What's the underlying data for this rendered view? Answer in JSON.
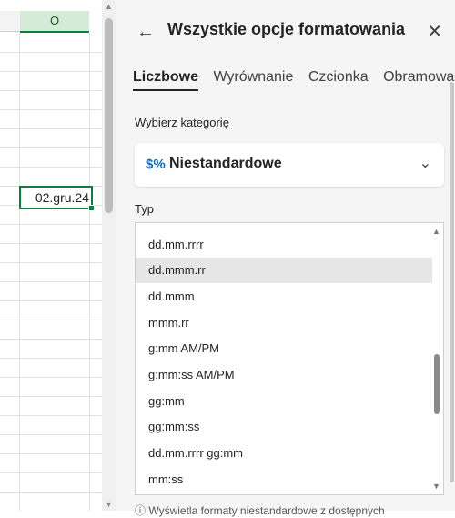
{
  "sheet": {
    "column_header": "O",
    "active_cell_value": "02.gru.24"
  },
  "pane": {
    "title": "Wszystkie opcje formatowania",
    "tabs": [
      {
        "label": "Liczbowe",
        "active": true
      },
      {
        "label": "Wyrównanie",
        "active": false
      },
      {
        "label": "Czcionka",
        "active": false
      },
      {
        "label": "Obramowanie",
        "active": false
      }
    ],
    "category_label": "Wybierz kategorię",
    "category_value": "Niestandardowe",
    "category_icon": "$%",
    "type_label": "Typ",
    "type_items": [
      "dd.mm.rrrr",
      "dd.mmm.rr",
      "dd.mmm",
      "mmm.rr",
      "g:mm AM/PM",
      "g:mm:ss AM/PM",
      "gg:mm",
      "gg:mm:ss",
      "dd.mm.rrrr gg:mm",
      "mm:ss"
    ],
    "selected_type": "dd.mmm.rr",
    "footnote": "Wyświetla formaty niestandardowe z dostępnych"
  },
  "colors": {
    "accent_green": "#107c41",
    "header_bg": "#d6ead8",
    "pane_bg": "#f5f5f5"
  }
}
